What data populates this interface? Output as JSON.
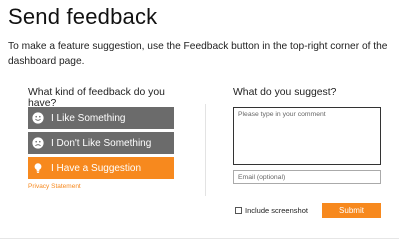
{
  "page": {
    "title": "Send feedback",
    "intro": "To make a feature suggestion, use the Feedback button in the top-right corner of the dashboard page."
  },
  "feedback_kind": {
    "heading": "What kind of feedback do you have?",
    "options": [
      {
        "label": "I Like Something",
        "icon": "smile-icon",
        "selected": false
      },
      {
        "label": "I Don't Like Something",
        "icon": "frown-icon",
        "selected": false
      },
      {
        "label": "I Have a Suggestion",
        "icon": "lightbulb-icon",
        "selected": true
      }
    ],
    "privacy_link": "Privacy Statement"
  },
  "suggestion": {
    "heading": "What do you suggest?",
    "comment_placeholder": "Please type in your comment",
    "comment_value": "",
    "email_placeholder": "Email (optional)",
    "email_value": ""
  },
  "footer": {
    "include_screenshot_label": "Include screenshot",
    "include_screenshot_checked": false,
    "submit_label": "Submit"
  },
  "colors": {
    "accent": "#f7891e",
    "option_bg": "#6b6b6b",
    "option_text": "#ffffff"
  }
}
